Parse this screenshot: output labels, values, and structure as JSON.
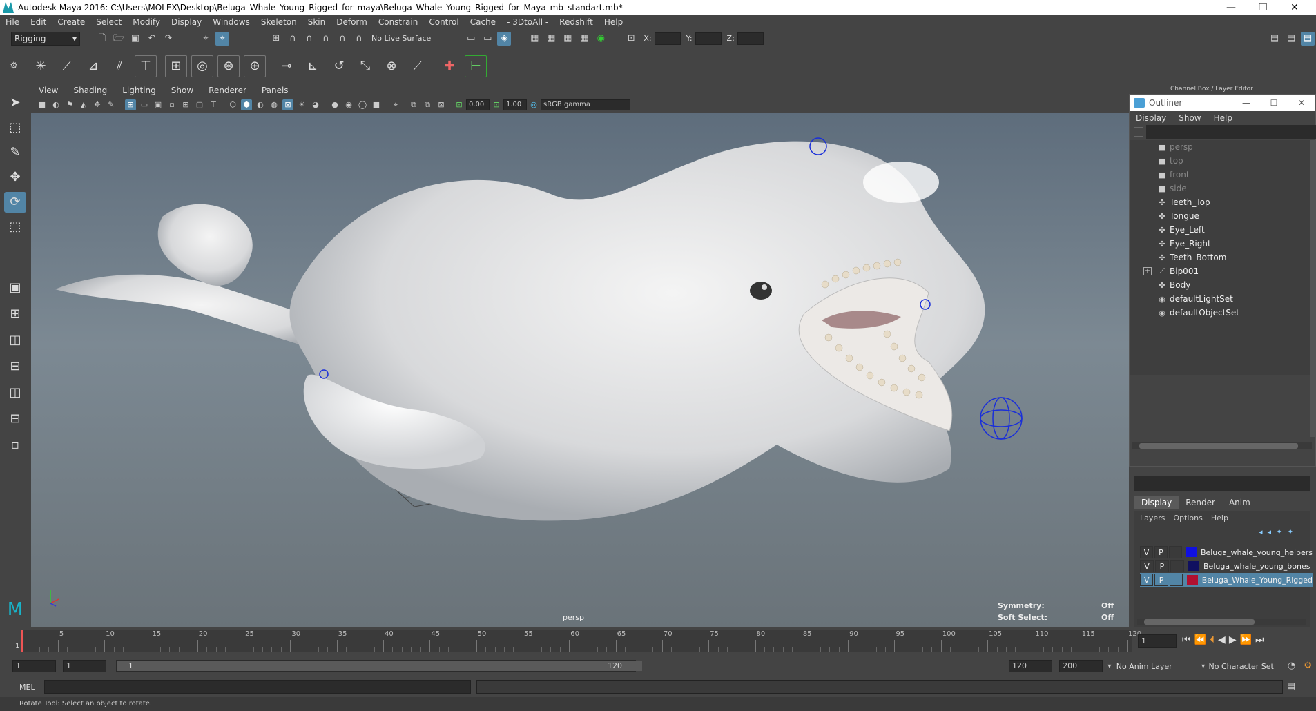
{
  "window": {
    "title": "Autodesk Maya 2016: C:\\Users\\MOLEX\\Desktop\\Beluga_Whale_Young_Rigged_for_maya\\Beluga_Whale_Young_Rigged_for_Maya_mb_standart.mb*",
    "minimize": "—",
    "restore": "❐",
    "close": "✕"
  },
  "menu": [
    "File",
    "Edit",
    "Create",
    "Select",
    "Modify",
    "Display",
    "Windows",
    "Skeleton",
    "Skin",
    "Deform",
    "Constrain",
    "Control",
    "Cache",
    "- 3DtoAll -",
    "Redshift",
    "Help"
  ],
  "status": {
    "mode": "Rigging",
    "live_surface": "No Live Surface",
    "x_label": "X:",
    "y_label": "Y:",
    "z_label": "Z:"
  },
  "viewport": {
    "menu": [
      "View",
      "Shading",
      "Lighting",
      "Show",
      "Renderer",
      "Panels"
    ],
    "exposure": "0.00",
    "gamma": "1.00",
    "colorspace": "sRGB gamma",
    "camera": "persp",
    "symmetry_label": "Symmetry:",
    "symmetry_value": "Off",
    "softselect_label": "Soft Select:",
    "softselect_value": "Off"
  },
  "channelbox": {
    "title": "Channel Box / Layer Editor"
  },
  "outliner": {
    "title": "Outliner",
    "min": "—",
    "max": "☐",
    "close": "✕",
    "menu": [
      "Display",
      "Show",
      "Help"
    ],
    "items": [
      {
        "label": "persp",
        "icon": "camera-icon",
        "dim": true
      },
      {
        "label": "top",
        "icon": "camera-icon",
        "dim": true
      },
      {
        "label": "front",
        "icon": "camera-icon",
        "dim": true
      },
      {
        "label": "side",
        "icon": "camera-icon",
        "dim": true
      },
      {
        "label": "Teeth_Top",
        "icon": "mesh-icon",
        "dim": false
      },
      {
        "label": "Tongue",
        "icon": "mesh-icon",
        "dim": false
      },
      {
        "label": "Eye_Left",
        "icon": "mesh-icon",
        "dim": false
      },
      {
        "label": "Eye_Right",
        "icon": "mesh-icon",
        "dim": false
      },
      {
        "label": "Teeth_Bottom",
        "icon": "mesh-icon",
        "dim": false
      },
      {
        "label": "Bip001",
        "icon": "joint-icon",
        "dim": false
      },
      {
        "label": "Body",
        "icon": "mesh-icon",
        "dim": false
      },
      {
        "label": "defaultLightSet",
        "icon": "set-icon",
        "dim": false
      },
      {
        "label": "defaultObjectSet",
        "icon": "set-icon",
        "dim": false
      }
    ]
  },
  "layers": {
    "tabs": [
      "Display",
      "Render",
      "Anim"
    ],
    "menu": [
      "Layers",
      "Options",
      "Help"
    ],
    "rows": [
      {
        "v": "V",
        "p": "P",
        "name": "Beluga_whale_young_helpers",
        "color": "#1010e0",
        "selected": false
      },
      {
        "v": "V",
        "p": "P",
        "name": "Beluga_whale_young_bones",
        "color": "#101060",
        "selected": false
      },
      {
        "v": "V",
        "p": "P",
        "name": "Beluga_Whale_Young_Rigged",
        "color": "#b01030",
        "selected": true
      }
    ]
  },
  "timeline": {
    "ticks": [
      "5",
      "10",
      "15",
      "20",
      "25",
      "30",
      "35",
      "40",
      "45",
      "50",
      "55",
      "60",
      "65",
      "70",
      "75",
      "80",
      "85",
      "90",
      "95",
      "100",
      "105",
      "110",
      "115",
      "120"
    ],
    "start_mark": "1",
    "current": "1"
  },
  "range": {
    "start": "1",
    "start2": "1",
    "slider_start": "1",
    "slider_end": "120",
    "end": "120",
    "end2": "200",
    "anim_layer": "No Anim Layer",
    "char_set": "No Character Set"
  },
  "cmd": {
    "label": "MEL"
  },
  "help": {
    "text": "Rotate Tool: Select an object to rotate."
  }
}
